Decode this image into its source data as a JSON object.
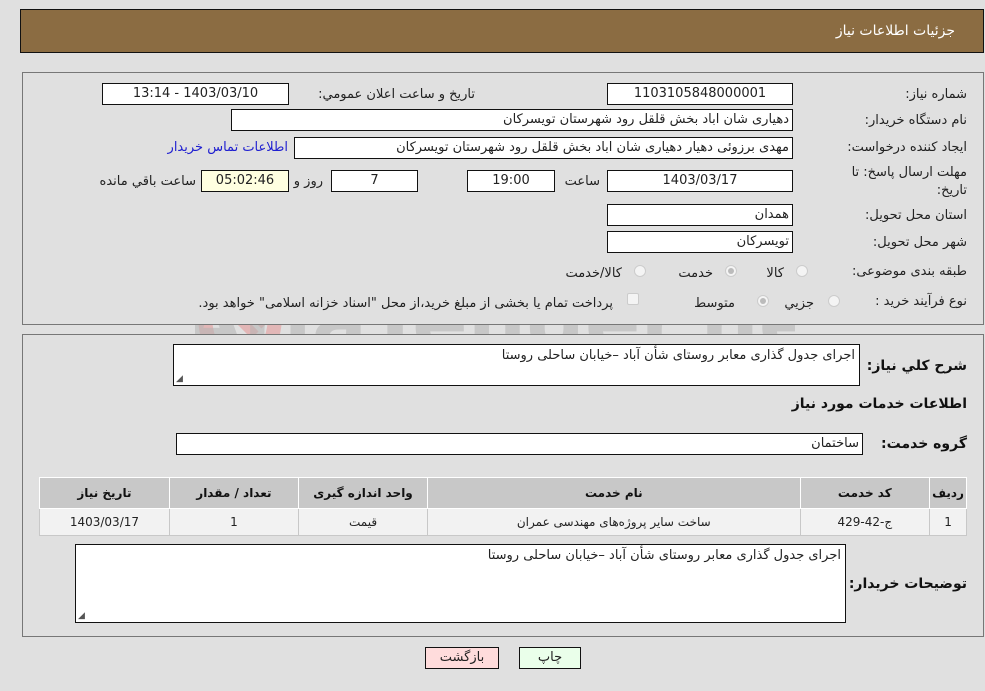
{
  "header": {
    "title": "جزئیات اطلاعات نیاز"
  },
  "form": {
    "need_number": {
      "label": "شماره نیاز:",
      "value": "1103105848000001"
    },
    "announce_datetime": {
      "label": "تاریخ و ساعت اعلان عمومي:",
      "value": "1403/03/10 - 13:14"
    },
    "buyer_org": {
      "label": "نام دستگاه خریدار:",
      "value": "دهیاری شان اباد بخش قلقل رود شهرستان تویسرکان"
    },
    "requester": {
      "label": "ایجاد کننده درخواست:",
      "value": "مهدی برزوئی دهیار دهیاری شان اباد بخش قلقل رود شهرستان تویسرکان"
    },
    "contact_link": "اطلاعات تماس خریدار",
    "deadline": {
      "label_line1": "مهلت ارسال پاسخ: تا",
      "label_line2": "تاریخ:",
      "date": "1403/03/17",
      "time_label": "ساعت",
      "time": "19:00",
      "days": "7",
      "days_label": "روز و",
      "remaining": "05:02:46",
      "remaining_label": "ساعت باقي مانده"
    },
    "province": {
      "label": "استان محل تحویل:",
      "value": "همدان"
    },
    "city": {
      "label": "شهر محل تحویل:",
      "value": "تویسرکان"
    },
    "category": {
      "label": "طبقه بندی موضوعی:",
      "options": [
        "کالا",
        "خدمت",
        "کالا/خدمت"
      ],
      "selected": "خدمت"
    },
    "process": {
      "label": "نوع فرآیند خرید :",
      "options": [
        "جزیي",
        "متوسط"
      ],
      "selected": "متوسط",
      "treasury_note": "پرداخت تمام یا بخشی از مبلغ خرید،از محل \"اسناد خزانه اسلامی\" خواهد بود."
    }
  },
  "details": {
    "summary_label": "شرح کلي نیاز:",
    "summary_value": "اجرای جدول گذاری معابر روستای شأن آباد –خیابان ساحلی روستا",
    "services_title": "اطلاعات خدمات مورد نیاز",
    "service_group_label": "گروه خدمت:",
    "service_group_value": "ساختمان",
    "table": {
      "headers": [
        "ردیف",
        "کد خدمت",
        "نام خدمت",
        "واحد اندازه گیری",
        "تعداد / مقدار",
        "تاریخ نیاز"
      ],
      "rows": [
        [
          "1",
          "ج-42-429",
          "ساخت سایر پروژه‌های مهندسی عمران",
          "قیمت",
          "1",
          "1403/03/17"
        ]
      ]
    },
    "buyer_notes_label": "توضیحات خریدار:",
    "buyer_notes_value": "اجرای جدول گذاری معابر روستای شأن آباد –خیابان ساحلی روستا"
  },
  "buttons": {
    "print": "چاپ",
    "back": "بازگشت"
  },
  "colors": {
    "header_bg": "#8b6c42",
    "link": "#2020d0",
    "print_bg": "#eaffea",
    "back_bg": "#ffdcdc",
    "remaining_bg": "#ffffe0"
  }
}
